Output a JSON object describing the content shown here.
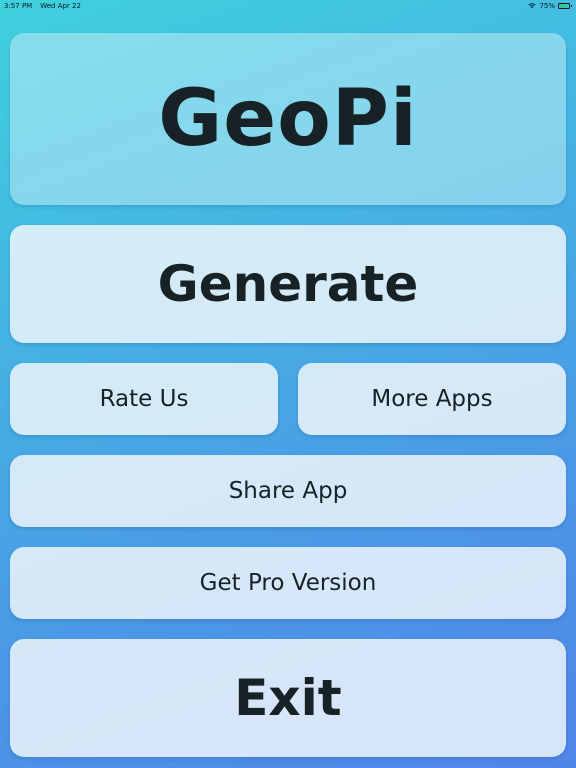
{
  "status_bar": {
    "time": "3:57 PM",
    "date": "Wed Apr 22",
    "battery_percent": "75%",
    "battery_level": 0.75,
    "wifi_icon": "wifi-icon",
    "battery_icon": "battery-icon"
  },
  "app": {
    "title": "GeoPi"
  },
  "buttons": {
    "generate": "Generate",
    "rate_us": "Rate Us",
    "more_apps": "More Apps",
    "share_app": "Share App",
    "get_pro": "Get Pro Version",
    "exit": "Exit"
  },
  "colors": {
    "background_top": "#3fd1dd",
    "background_bottom": "#5186e8",
    "card": "#ecf4fa",
    "text": "#172226"
  }
}
